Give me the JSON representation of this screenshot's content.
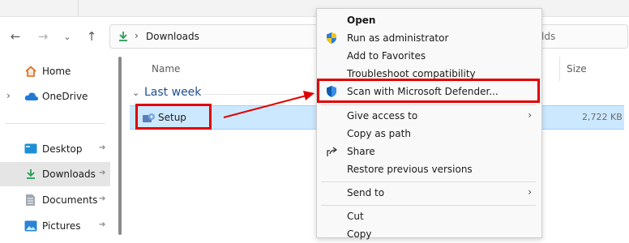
{
  "breadcrumb": {
    "current": "Downloads"
  },
  "search": {
    "placeholder_visible": "lds"
  },
  "sidebar": {
    "items": [
      {
        "label": "Home"
      },
      {
        "label": "OneDrive"
      },
      {
        "label": "Desktop"
      },
      {
        "label": "Downloads"
      },
      {
        "label": "Documents"
      },
      {
        "label": "Pictures"
      }
    ]
  },
  "file_list": {
    "columns": {
      "name": "Name",
      "size": "Size"
    },
    "group_label": "Last week",
    "rows": [
      {
        "name": "Setup",
        "size": "2,722 KB"
      }
    ]
  },
  "context_menu": {
    "items": [
      {
        "label": "Open"
      },
      {
        "label": "Run as administrator"
      },
      {
        "label": "Add to Favorites"
      },
      {
        "label": "Troubleshoot compatibility"
      },
      {
        "label": "Scan with Microsoft Defender..."
      },
      {
        "label": "Give access to"
      },
      {
        "label": "Copy as path"
      },
      {
        "label": "Share"
      },
      {
        "label": "Restore previous versions"
      },
      {
        "label": "Send to"
      },
      {
        "label": "Cut"
      },
      {
        "label": "Copy"
      }
    ]
  },
  "colors": {
    "highlight": "#cce8ff",
    "annotation_red": "#e00000",
    "group_blue": "#1f4f8f"
  }
}
